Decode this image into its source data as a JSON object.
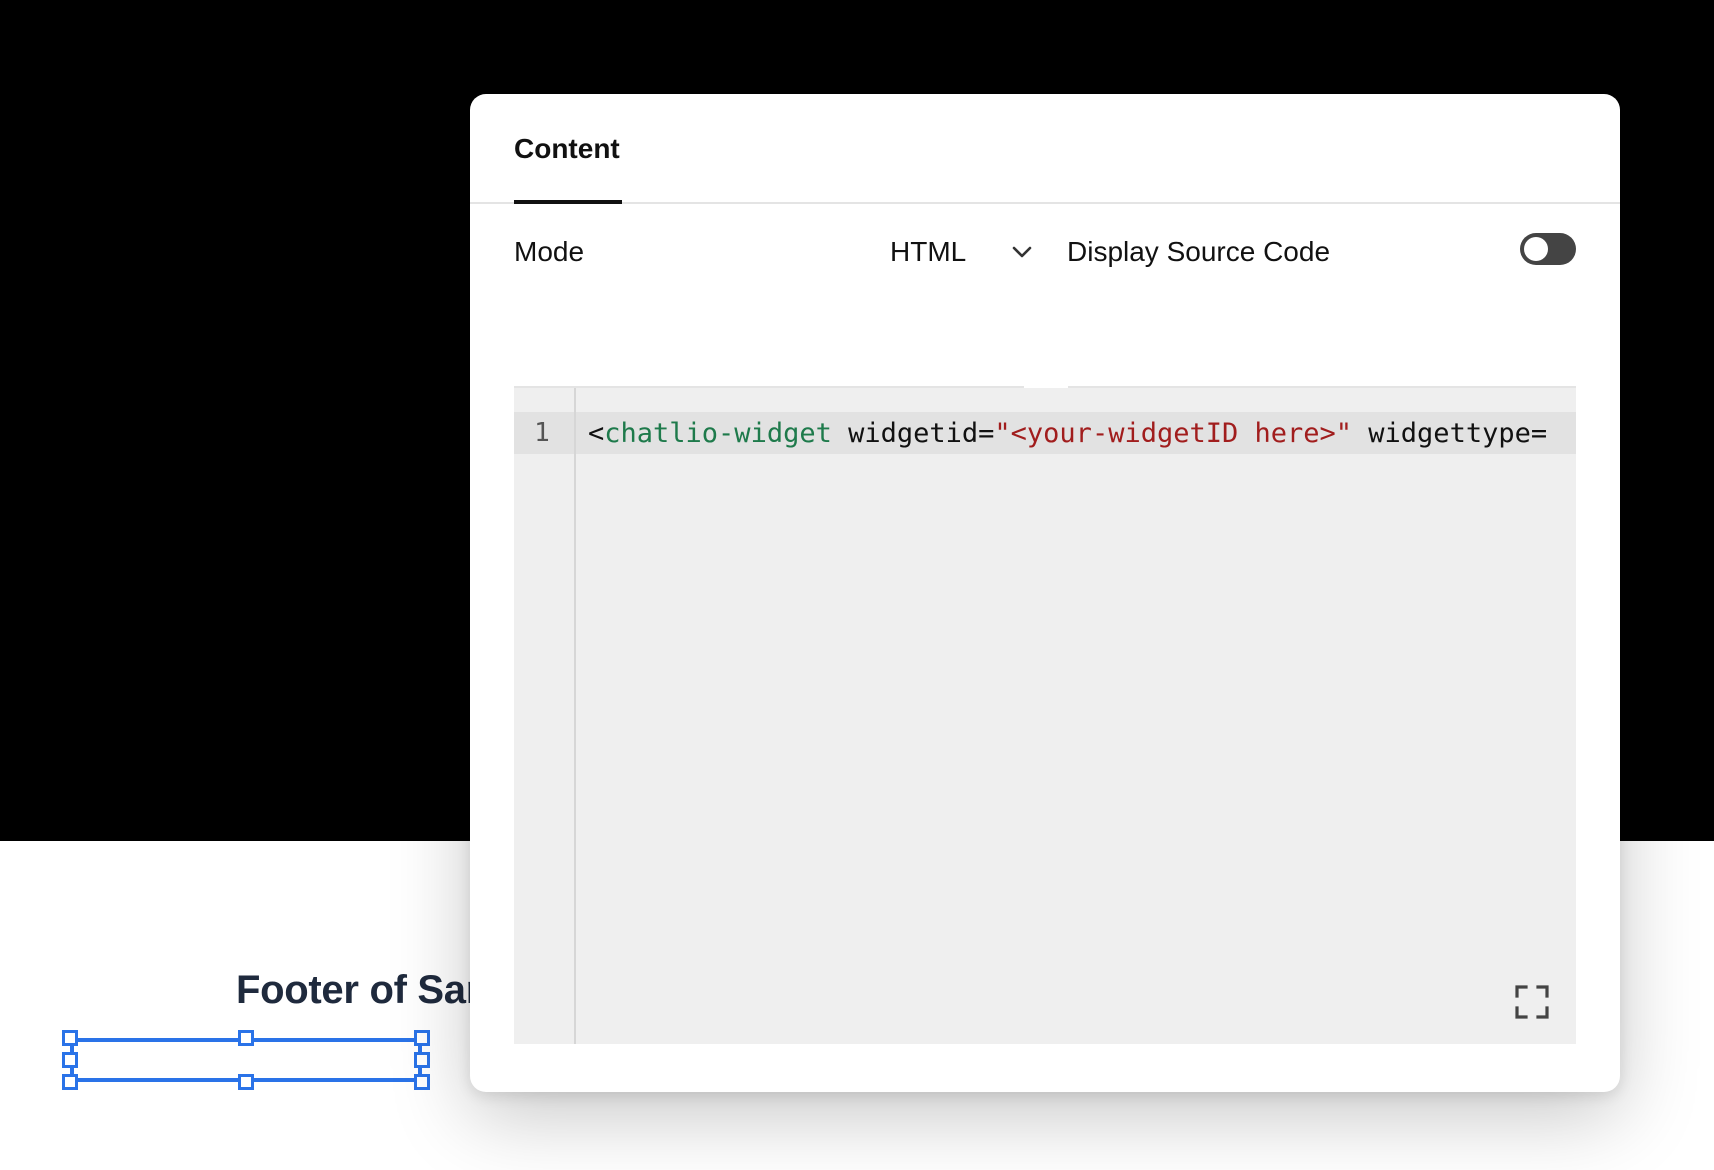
{
  "panel": {
    "tab_label": "Content",
    "mode": {
      "label": "Mode",
      "selected_value": "HTML"
    },
    "display_source": {
      "label": "Display Source Code",
      "enabled": false
    },
    "editor": {
      "line_number": "1",
      "tokens": {
        "open": "<",
        "tag_name": "chatlio-widget",
        "attr1": " widgetid=",
        "value1": "\"<your-widgetID here>\"",
        "attr2": " widgettype="
      }
    }
  },
  "page": {
    "footer_title": "Footer of Sar"
  },
  "colors": {
    "selection": "#2a73e8",
    "code_tag": "#1e7a4b",
    "code_string": "#a11d1d",
    "toggle_off": "#444444"
  },
  "icons": {
    "mode_dropdown": "chevron-down-icon",
    "editor_expand": "expand-icon"
  }
}
